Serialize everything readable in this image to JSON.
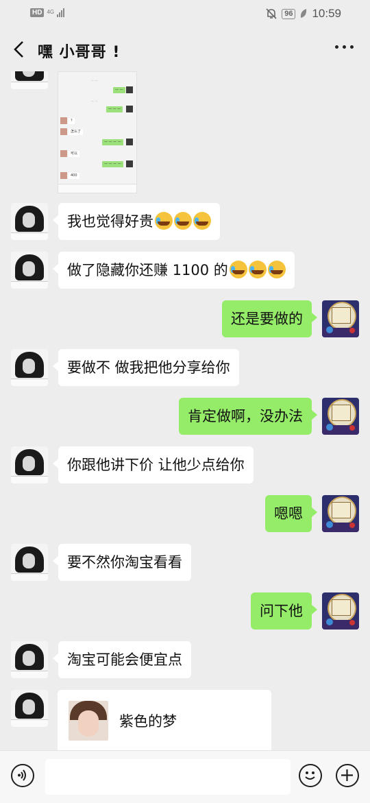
{
  "status_bar": {
    "hd": "HD",
    "network": "4G",
    "battery": "96",
    "time": "10:59"
  },
  "header": {
    "title": "嘿 小哥哥 !",
    "back_icon": "chevron-left-icon",
    "more_icon": "more-dots-icon"
  },
  "messages": [
    {
      "side": "left",
      "text": "我也觉得好贵",
      "emojis": 3
    },
    {
      "side": "left",
      "text": "做了隐藏你还赚 1100 的",
      "emojis": 3
    },
    {
      "side": "right",
      "text": "还是要做的"
    },
    {
      "side": "left",
      "text": "要做不 做我把他分享给你"
    },
    {
      "side": "right",
      "text": "肯定做啊，没办法"
    },
    {
      "side": "left",
      "text": "你跟他讲下价 让他少点给你"
    },
    {
      "side": "right",
      "text": "嗯嗯"
    },
    {
      "side": "left",
      "text": "要不然你淘宝看看"
    },
    {
      "side": "right",
      "text": "问下他"
    },
    {
      "side": "left",
      "text": "淘宝可能会便宜点"
    }
  ],
  "screenshot_rows": [
    "?",
    "怎么了",
    "可以",
    "400"
  ],
  "share_card": {
    "title": "紫色的梦"
  },
  "input_bar": {
    "value": "",
    "voice_icon": "voice-icon",
    "emoji_icon": "emoji-icon",
    "plus_icon": "plus-icon"
  },
  "colors": {
    "background": "#ededed",
    "bubble_mine": "#95ec69",
    "bubble_other": "#ffffff"
  }
}
